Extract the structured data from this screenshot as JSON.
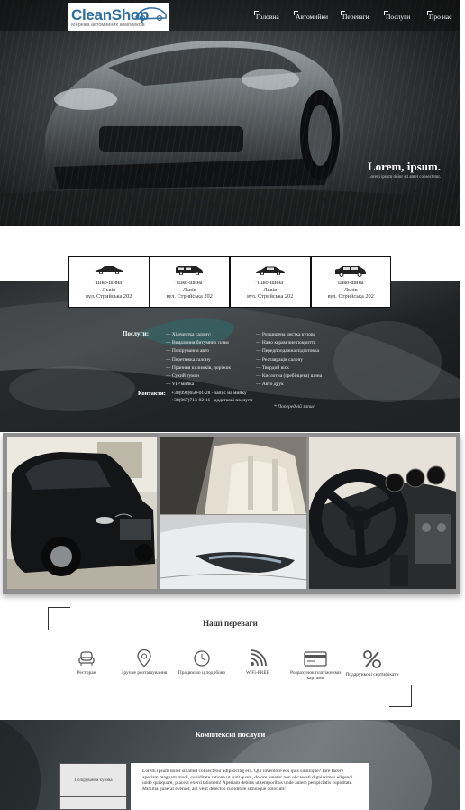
{
  "header": {
    "logo_text": "CleanShop",
    "logo_tagline": "Мережа автомийних комплексів",
    "nav": [
      {
        "label": "Головна"
      },
      {
        "label": "Автомийки"
      },
      {
        "label": "Переваги"
      },
      {
        "label": "Послуги"
      },
      {
        "label": "Про нас"
      }
    ]
  },
  "hero": {
    "title": "Lorem, ipsum.",
    "subtitle": "Lorem ipsum dolor sit amet consectetur."
  },
  "locations": [
    {
      "name": "\"Шко-шина\"",
      "city": "Львів",
      "address": "вул. Стрийська 202",
      "icon": "car-icon"
    },
    {
      "name": "\"Шко-шина\"",
      "city": "Львів",
      "address": "вул. Стрийська 202",
      "icon": "van-icon"
    },
    {
      "name": "\"Шко-шина\"",
      "city": "Львів",
      "address": "вул. Стрийська 202",
      "icon": "sedan-icon"
    },
    {
      "name": "\"Шко-шина\"",
      "city": "Львів",
      "address": "вул. Стрийська 202",
      "icon": "suv-icon"
    }
  ],
  "services": {
    "label": "Послуги:",
    "col1": [
      "— Хімчистка салону;",
      "— Видалення битумних плям",
      "— Полірування авто",
      "— Перетяжка салону",
      "— Пранння килимків, доріжок",
      "— Сухий туман",
      "— VIP мийка"
    ],
    "col2": [
      "— Розширена чистка кузова",
      "— Нано керамічне покриття",
      "— Передпродажна підготовка",
      "— Реставрація салону",
      "— Твердий віск",
      "— Кислотна (гребінцева) шина",
      "— Авто друк"
    ]
  },
  "contacts": {
    "label": "Контакти:",
    "lines": [
      "+38(098)650-01-28 - запис на мийку",
      "+38(067)713-92-11 - додаткові послуги"
    ],
    "note": "* Попередній запис"
  },
  "gallery": [
    {
      "alt": "black-suv-photo"
    },
    {
      "alt": "car-interior-seats-photo"
    },
    {
      "alt": "white-car-headlight-photo"
    },
    {
      "alt": "steering-wheel-dashboard-photo"
    }
  ],
  "advantages": {
    "title": "Наші переваги",
    "items": [
      {
        "label": "Ресторан",
        "icon": "armchair-icon"
      },
      {
        "label": "Зручне розташування",
        "icon": "map-pin-icon"
      },
      {
        "label": "Працюємо цілодобово",
        "icon": "clock-icon"
      },
      {
        "label": "WiFi-FREE",
        "icon": "wifi-icon"
      },
      {
        "label": "Розрахунок платіжними картами",
        "icon": "credit-card-icon"
      },
      {
        "label": "Подарункові сертифікати",
        "icon": "percent-icon"
      }
    ]
  },
  "complex": {
    "title": "Комплексні послуги",
    "tabs": [
      "Полірування кузова",
      ""
    ],
    "text": "Lorem ipsum dolor sit amet consectetur adipisicing elit. Qui inventore eos quis similique? Iure facere aperiam magnam modi, cupiditate ratione ut sunt quam, dolore tenetur non obcaecati dignissimos eligendi unde quisquam, placeat exercitationem! Aperiam debitis ut temporibus unde autem perspiciatis cupiditate. Minima quaerat eveniet, aut velit delectus cupiditate similique dolorum!"
  },
  "colors": {
    "logo_blue": "#2d6f9e",
    "band_dark": "#2b2e30",
    "gallery_frame": "#8f8f8f"
  }
}
